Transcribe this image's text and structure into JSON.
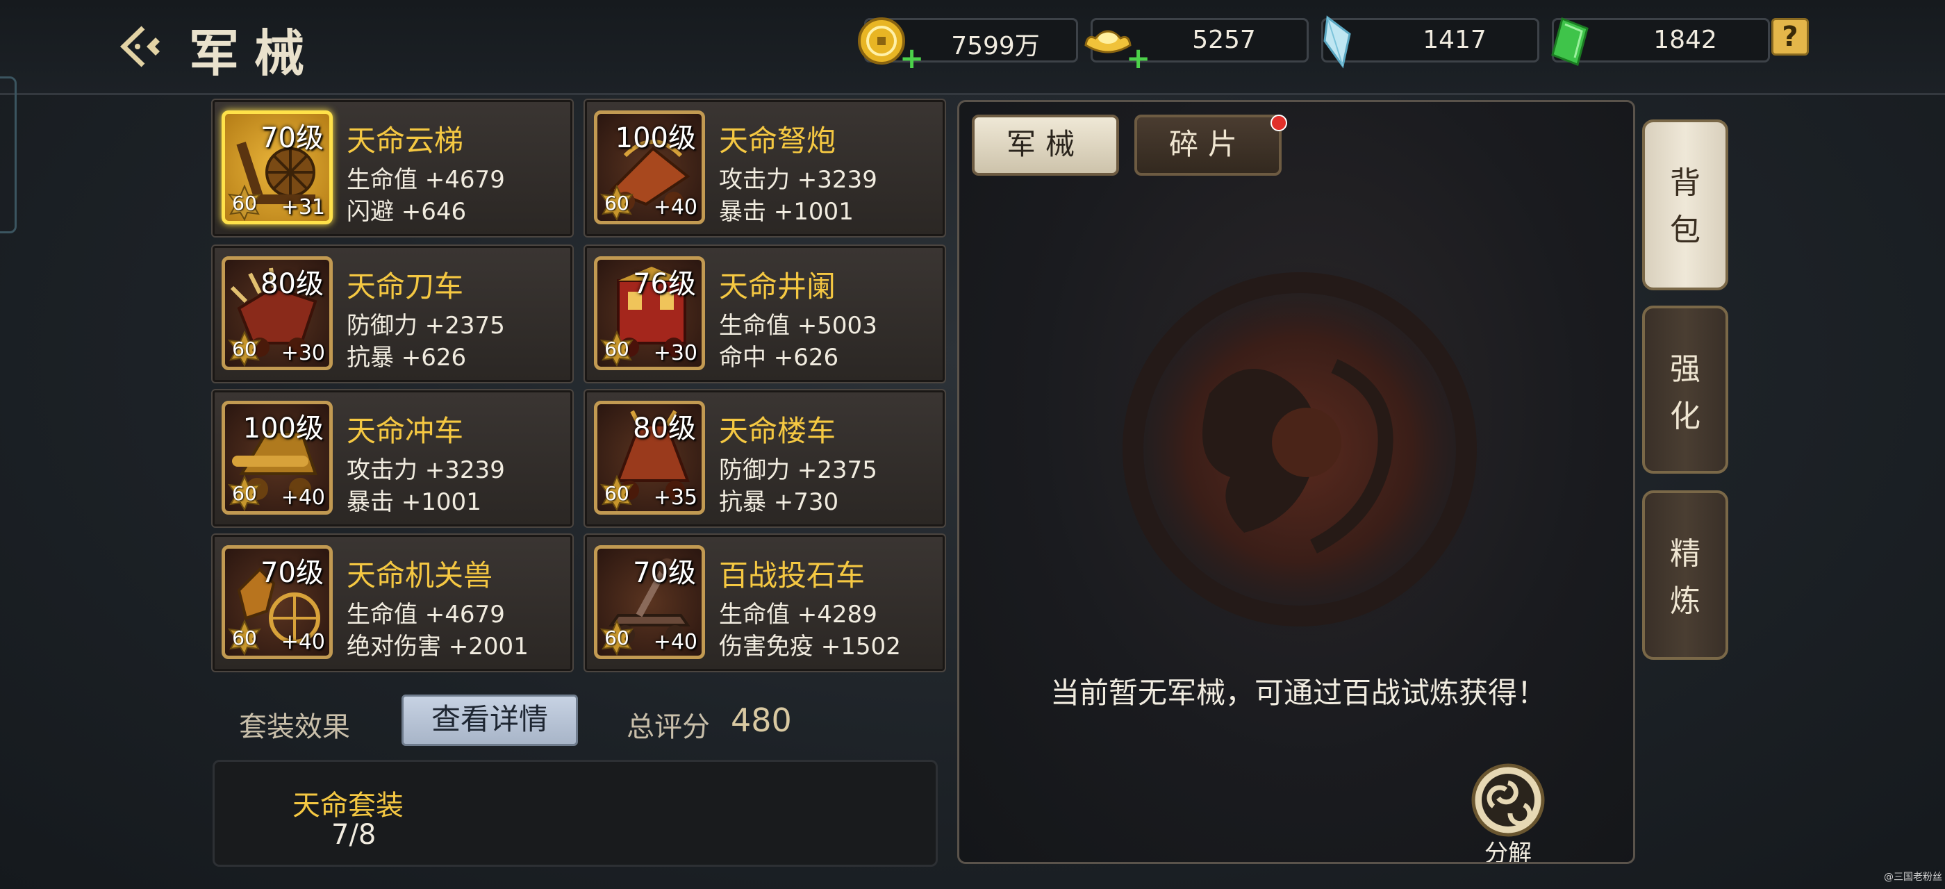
{
  "header": {
    "title": "军械"
  },
  "resources": [
    {
      "icon": "gold-coin-icon",
      "value": "7599万",
      "has_plus": true
    },
    {
      "icon": "gold-ingot-icon",
      "value": "5257",
      "has_plus": true
    },
    {
      "icon": "crystal-icon",
      "value": "1417",
      "has_plus": false
    },
    {
      "icon": "jade-icon",
      "value": "1842",
      "has_plus": false
    }
  ],
  "help_label": "?",
  "equipment": [
    {
      "level": "70级",
      "badge": "60",
      "plus": "+31",
      "name": "天命云梯",
      "stat1": "生命值 +4679",
      "stat2": "闪避 +646",
      "selected": true
    },
    {
      "level": "100级",
      "badge": "60",
      "plus": "+40",
      "name": "天命弩炮",
      "stat1": "攻击力 +3239",
      "stat2": "暴击 +1001",
      "selected": false
    },
    {
      "level": "80级",
      "badge": "60",
      "plus": "+30",
      "name": "天命刀车",
      "stat1": "防御力 +2375",
      "stat2": "抗暴 +626",
      "selected": false
    },
    {
      "level": "76级",
      "badge": "60",
      "plus": "+30",
      "name": "天命井阑",
      "stat1": "生命值 +5003",
      "stat2": "命中 +626",
      "selected": false
    },
    {
      "level": "100级",
      "badge": "60",
      "plus": "+40",
      "name": "天命冲车",
      "stat1": "攻击力 +3239",
      "stat2": "暴击 +1001",
      "selected": false
    },
    {
      "level": "80级",
      "badge": "60",
      "plus": "+35",
      "name": "天命楼车",
      "stat1": "防御力 +2375",
      "stat2": "抗暴 +730",
      "selected": false
    },
    {
      "level": "70级",
      "badge": "60",
      "plus": "+40",
      "name": "天命机关兽",
      "stat1": "生命值 +4679",
      "stat2": "绝对伤害 +2001",
      "selected": false
    },
    {
      "level": "70级",
      "badge": "60",
      "plus": "+40",
      "name": "百战投石车",
      "stat1": "生命值 +4289",
      "stat2": "伤害免疫 +1502",
      "selected": false
    }
  ],
  "set_effect": {
    "label": "套装效果",
    "detail_button": "查看详情",
    "score_label": "总评分",
    "score": "480",
    "set_name": "天命套装",
    "set_count": "7/8"
  },
  "panel": {
    "tabs": [
      "军械",
      "碎片"
    ],
    "active_tab": "军械",
    "empty_message": "当前暂无军械，可通过百战试炼获得！",
    "decompose_label": "分解"
  },
  "side_tabs": [
    "背包",
    "强化",
    "精炼"
  ],
  "watermark": "@三国老粉丝"
}
